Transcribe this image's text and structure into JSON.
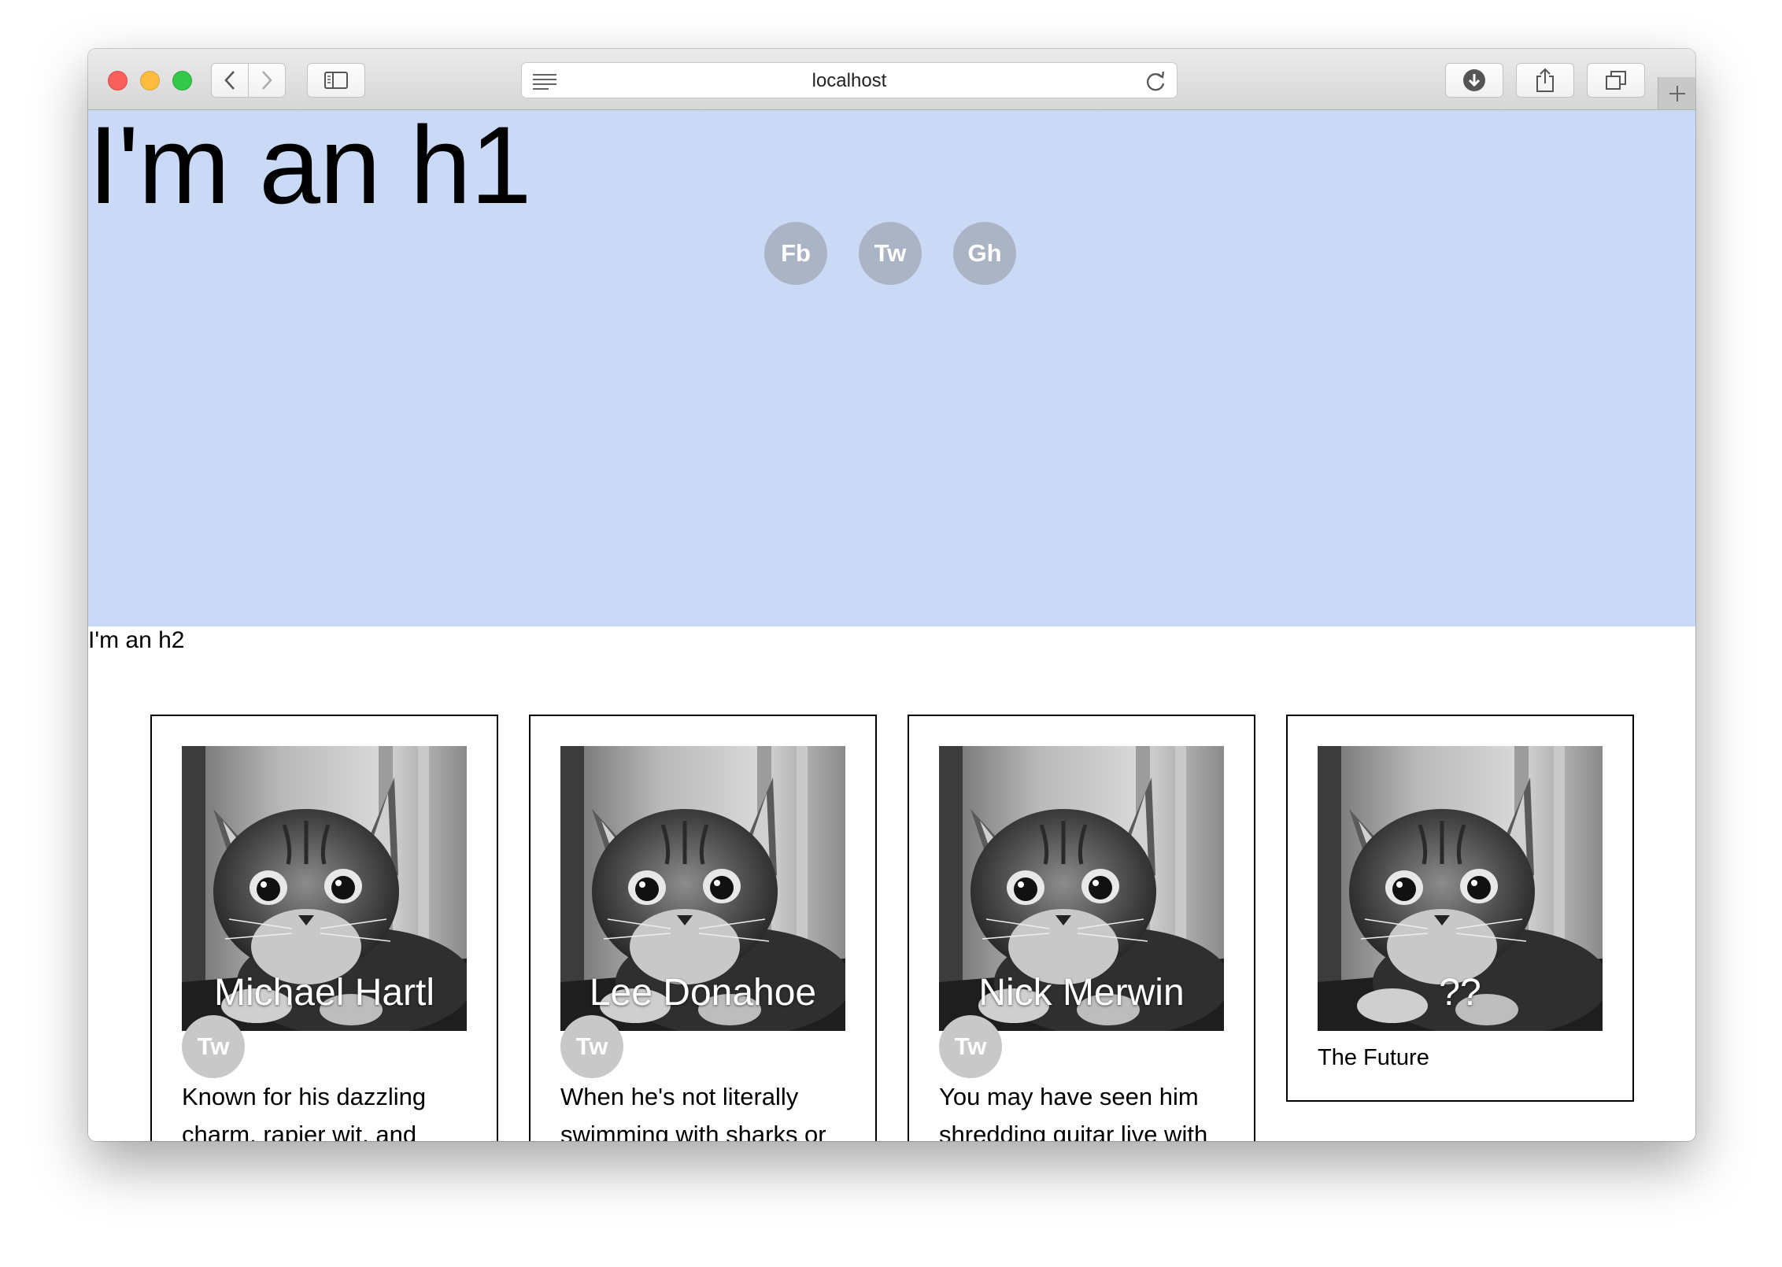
{
  "browser": {
    "url": "localhost"
  },
  "hero": {
    "heading": "I'm an h1",
    "social": [
      {
        "label": "Fb"
      },
      {
        "label": "Tw"
      },
      {
        "label": "Gh"
      }
    ],
    "background_color": "#c9d9f6"
  },
  "section": {
    "heading": "I'm an h2"
  },
  "cards": [
    {
      "name": "Michael Hartl",
      "social": "Tw",
      "bio": "Known for his dazzling charm, rapier wit, and"
    },
    {
      "name": "Lee Donahoe",
      "social": "Tw",
      "bio": "When he's not literally swimming with sharks or"
    },
    {
      "name": "Nick Merwin",
      "social": "Tw",
      "bio": "You may have seen him shredding guitar live with"
    },
    {
      "name": "??",
      "caption": "The Future"
    }
  ]
}
